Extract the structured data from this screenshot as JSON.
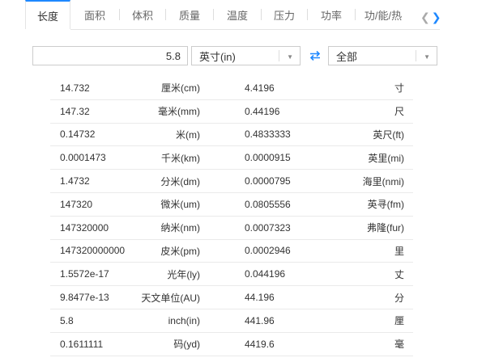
{
  "tabs": [
    {
      "label": "长度",
      "active": true
    },
    {
      "label": "面积"
    },
    {
      "label": "体积"
    },
    {
      "label": "质量"
    },
    {
      "label": "温度"
    },
    {
      "label": "压力"
    },
    {
      "label": "功率"
    },
    {
      "label": "功/能/热"
    }
  ],
  "icons": {
    "left": "chevron-left-icon",
    "right": "chevron-right-icon",
    "swap": "swap-arrows-icon",
    "caret": "caret-down-icon"
  },
  "colors": {
    "accent": "#1e88ff",
    "border": "#cccccc",
    "text": "#333333"
  },
  "input": {
    "value": "5.8"
  },
  "unit_select": {
    "value": "英寸(in)"
  },
  "filter_select": {
    "value": "全部"
  },
  "rows": [
    {
      "lv": "14.732",
      "lu": "厘米(cm)",
      "rv": "4.4196",
      "ru": "寸"
    },
    {
      "lv": "147.32",
      "lu": "毫米(mm)",
      "rv": "0.44196",
      "ru": "尺"
    },
    {
      "lv": "0.14732",
      "lu": "米(m)",
      "rv": "0.4833333",
      "ru": "英尺(ft)"
    },
    {
      "lv": "0.0001473",
      "lu": "千米(km)",
      "rv": "0.0000915",
      "ru": "英里(mi)"
    },
    {
      "lv": "1.4732",
      "lu": "分米(dm)",
      "rv": "0.0000795",
      "ru": "海里(nmi)"
    },
    {
      "lv": "147320",
      "lu": "微米(um)",
      "rv": "0.0805556",
      "ru": "英寻(fm)"
    },
    {
      "lv": "147320000",
      "lu": "纳米(nm)",
      "rv": "0.0007323",
      "ru": "弗隆(fur)"
    },
    {
      "lv": "147320000000",
      "lu": "皮米(pm)",
      "rv": "0.0002946",
      "ru": "里"
    },
    {
      "lv": "1.5572e-17",
      "lu": "光年(ly)",
      "rv": "0.044196",
      "ru": "丈"
    },
    {
      "lv": "9.8477e-13",
      "lu": "天文单位(AU)",
      "rv": "44.196",
      "ru": "分"
    },
    {
      "lv": "5.8",
      "lu": "inch(in)",
      "rv": "441.96",
      "ru": "厘"
    },
    {
      "lv": "0.1611111",
      "lu": "码(yd)",
      "rv": "4419.6",
      "ru": "毫"
    }
  ]
}
